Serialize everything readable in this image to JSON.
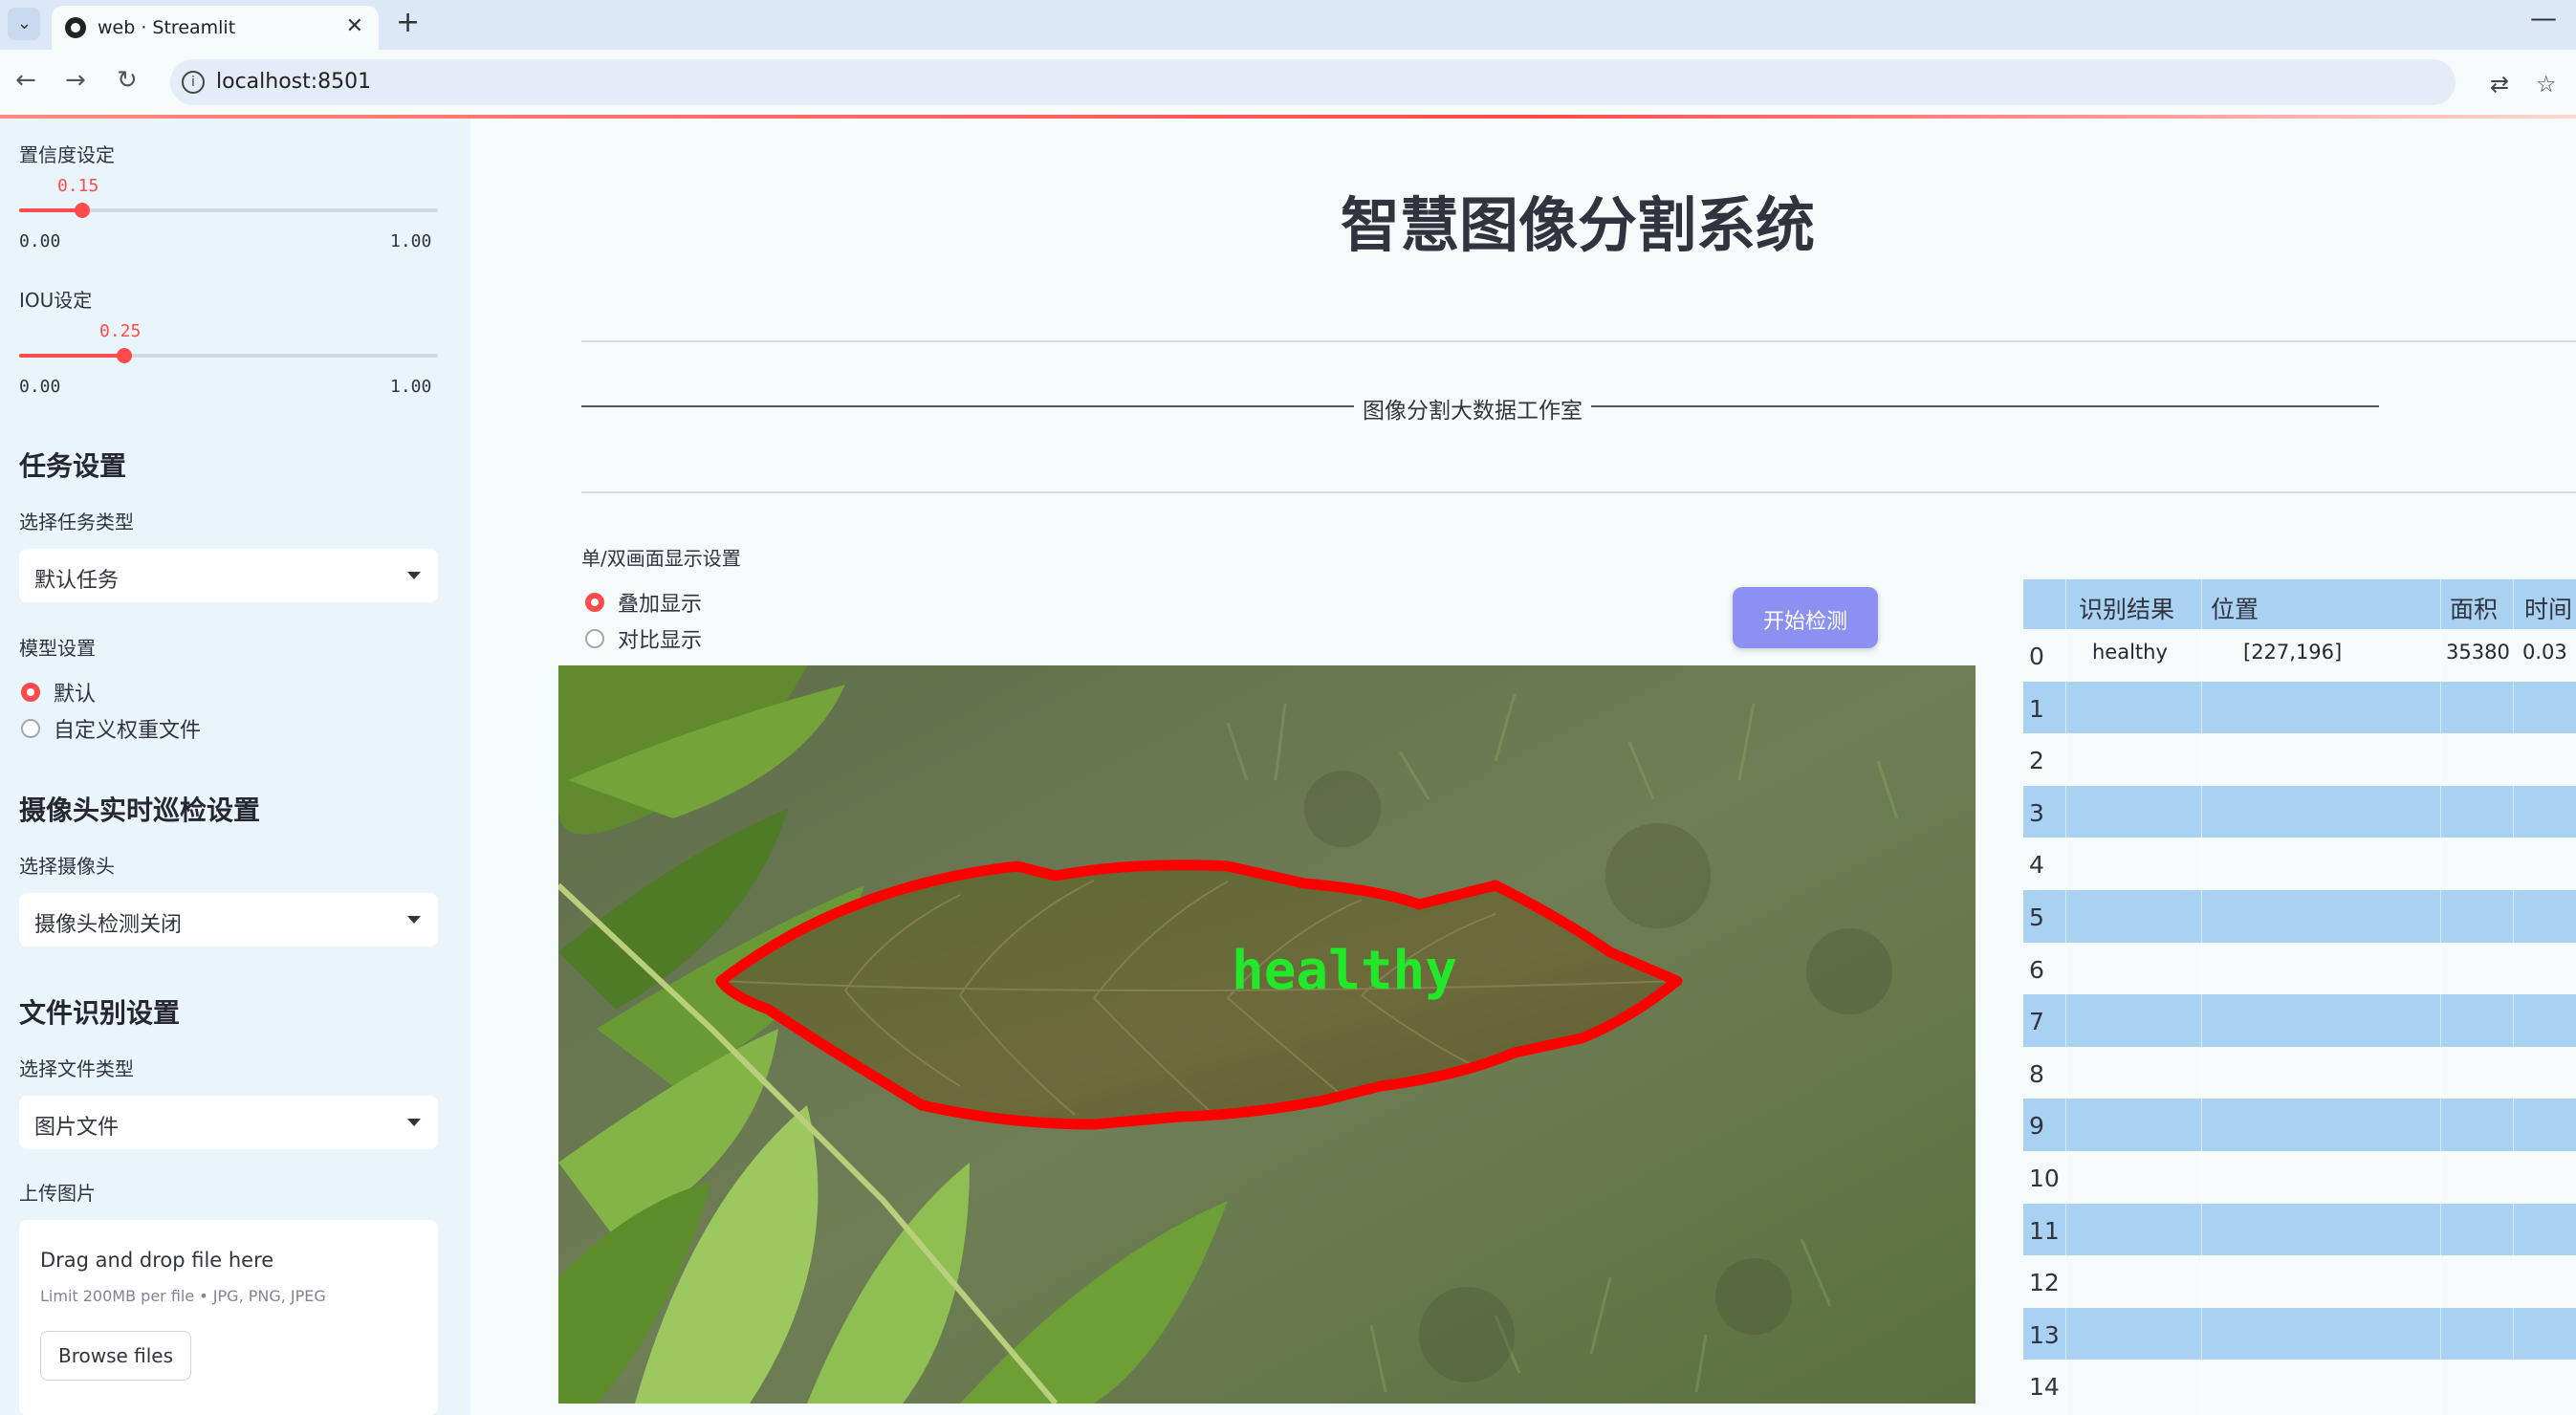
{
  "browser": {
    "tab_title": "web · Streamlit",
    "url": "localhost:8501"
  },
  "sidebar": {
    "confidence": {
      "label": "置信度设定",
      "value": "0.15",
      "min": "0.00",
      "max": "1.00",
      "fraction": 0.15
    },
    "iou": {
      "label": "IOU设定",
      "value": "0.25",
      "min": "0.00",
      "max": "1.00",
      "fraction": 0.25
    },
    "task": {
      "heading": "任务设置",
      "label": "选择任务类型",
      "value": "默认任务"
    },
    "model": {
      "label": "模型设置",
      "options": [
        "默认",
        "自定义权重文件"
      ],
      "selected": 0
    },
    "camera": {
      "heading": "摄像头实时巡检设置",
      "label": "选择摄像头",
      "value": "摄像头检测关闭"
    },
    "file": {
      "heading": "文件识别设置",
      "label": "选择文件类型",
      "value": "图片文件"
    },
    "upload": {
      "label": "上传图片",
      "drop_text": "Drag and drop file here",
      "limit_text": "Limit 200MB per file • JPG, PNG, JPEG",
      "button": "Browse files"
    }
  },
  "main": {
    "title": "智慧图像分割系统",
    "studio": "图像分割大数据工作室",
    "display": {
      "label": "单/双画面显示设置",
      "options": [
        "叠加显示",
        "对比显示"
      ],
      "selected": 0
    },
    "start_button": "开始检测",
    "detection_label": "healthy"
  },
  "table": {
    "columns": [
      "识别结果",
      "位置",
      "面积",
      "时间"
    ],
    "rows": [
      {
        "index": "0",
        "result": "healthy",
        "position": "[227,196]",
        "area": "35380",
        "time": "0.03"
      },
      {
        "index": "1"
      },
      {
        "index": "2"
      },
      {
        "index": "3"
      },
      {
        "index": "4"
      },
      {
        "index": "5"
      },
      {
        "index": "6"
      },
      {
        "index": "7"
      },
      {
        "index": "8"
      },
      {
        "index": "9"
      },
      {
        "index": "10"
      },
      {
        "index": "11"
      },
      {
        "index": "12"
      },
      {
        "index": "13"
      },
      {
        "index": "14"
      }
    ]
  },
  "colors": {
    "accent": "#ff4b4b",
    "button": "#8c91f1",
    "table_stripe": "#a9d1f2",
    "mask_outline": "#ff0000",
    "label_text": "#22e82a"
  }
}
